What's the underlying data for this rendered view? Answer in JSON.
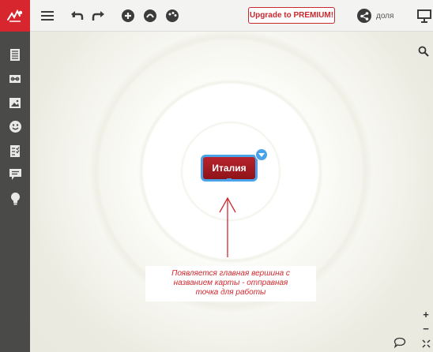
{
  "toolbar": {
    "upgrade_label": "Upgrade to PREMIUM!",
    "share_label": "доля",
    "icons": [
      "logo-icon",
      "menu-icon",
      "undo-icon",
      "redo-icon",
      "add-node-icon",
      "style-icon",
      "palette-icon",
      "share-icon",
      "present-icon"
    ]
  },
  "sidebar": {
    "icons": [
      "notes-icon",
      "link-icon",
      "image-icon",
      "emoji-icon",
      "task-icon",
      "comment-icon",
      "idea-icon"
    ]
  },
  "canvas": {
    "root_node_label": "Италия",
    "note_lines": [
      "Появляется главная вершина с",
      "названием карты - отправная",
      "точка для работы"
    ],
    "zoom_in": "+",
    "zoom_out": "−"
  },
  "colors": {
    "brand_red": "#d7262d",
    "node_red": "#a81c23",
    "selection_blue": "#4aa3e8",
    "annotation_red": "#d2282e"
  }
}
